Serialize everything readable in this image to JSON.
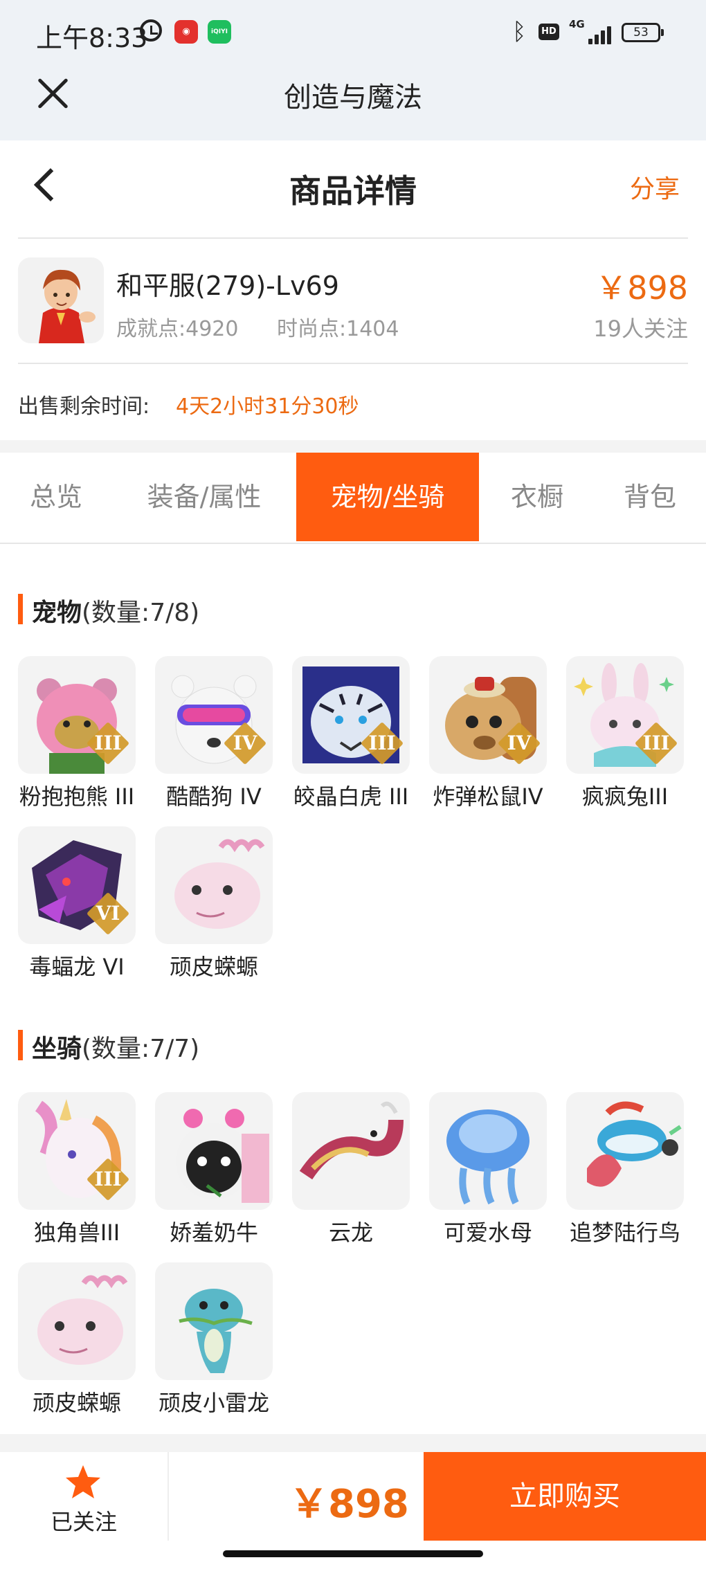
{
  "status_bar": {
    "time": "上午8:33",
    "network": "4G",
    "battery": "53"
  },
  "app_bar": {
    "title": "创造与魔法"
  },
  "header": {
    "title": "商品详情",
    "share": "分享"
  },
  "product": {
    "name": "和平服(279)-Lv69",
    "achievement": "成就点:4920",
    "fashion": "时尚点:1404",
    "price": "￥898",
    "followers": "19人关注",
    "remain_label": "出售剩余时间:",
    "remain_value": "4天2小时31分30秒"
  },
  "tabs": [
    "总览",
    "装备/属性",
    "宠物/坐骑",
    "衣橱",
    "背包"
  ],
  "active_tab": 2,
  "pets": {
    "title": "宠物",
    "count": "(数量:7/8)",
    "items": [
      {
        "name": "粉抱抱熊 III",
        "badge": "III",
        "icon": "pink-bear-icon"
      },
      {
        "name": "酷酷狗 IV",
        "badge": "IV",
        "icon": "cool-dog-icon"
      },
      {
        "name": "皎晶白虎 III",
        "badge": "III",
        "icon": "white-tiger-icon"
      },
      {
        "name": "炸弹松鼠IV",
        "badge": "IV",
        "icon": "bomb-squirrel-icon"
      },
      {
        "name": "疯疯兔III",
        "badge": "III",
        "icon": "crazy-rabbit-icon"
      },
      {
        "name": "毒蝠龙 VI",
        "badge": "VI",
        "icon": "poison-bat-dragon-icon"
      },
      {
        "name": "顽皮蝾螈",
        "badge": "",
        "icon": "naughty-axolotl-icon"
      }
    ]
  },
  "mounts": {
    "title": "坐骑",
    "count": "(数量:7/7)",
    "items": [
      {
        "name": "独角兽III",
        "badge": "III",
        "icon": "unicorn-icon"
      },
      {
        "name": "娇羞奶牛",
        "badge": "",
        "icon": "shy-cow-icon"
      },
      {
        "name": "云龙",
        "badge": "",
        "icon": "cloud-dragon-icon"
      },
      {
        "name": "可爱水母",
        "badge": "",
        "icon": "jellyfish-icon"
      },
      {
        "name": "追梦陆行鸟",
        "badge": "",
        "icon": "dream-chocobo-icon"
      },
      {
        "name": "顽皮蝾螈",
        "badge": "",
        "icon": "naughty-axolotl-icon"
      },
      {
        "name": "顽皮小雷龙",
        "badge": "",
        "icon": "naughty-thunder-dragon-icon"
      }
    ]
  },
  "bottom_bar": {
    "follow_label": "已关注",
    "price": "￥898",
    "buy_label": "立即购买"
  },
  "colors": {
    "accent": "#ff5c10",
    "price": "#ec6a12"
  }
}
